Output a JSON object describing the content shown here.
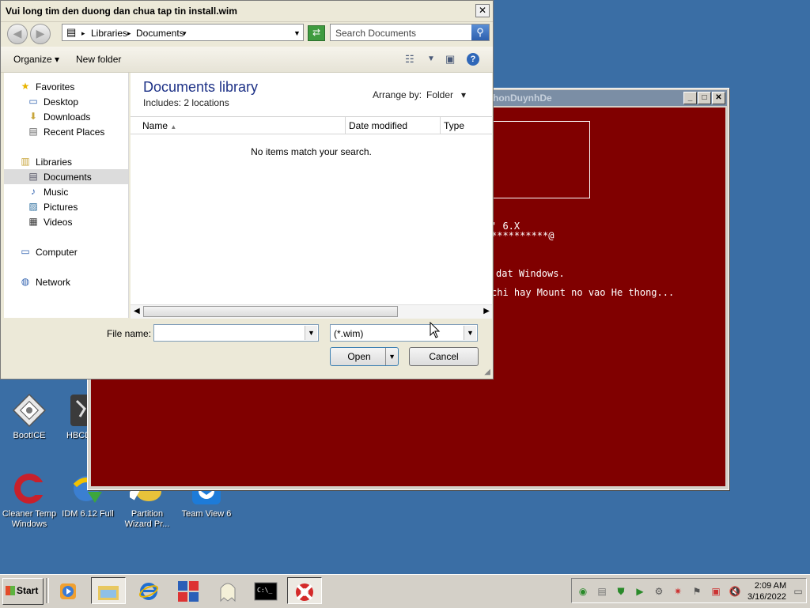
{
  "desktop": {
    "icons": [
      {
        "label": "BootICE"
      },
      {
        "label": "HBCD"
      },
      {
        "label": "Cleaner Temp Windows"
      },
      {
        "label": "IDM 6.12 Full"
      },
      {
        "label": "Partition Wizard Pr..."
      },
      {
        "label": "Team View 6"
      }
    ]
  },
  "console": {
    "title": "honDuynhDe",
    "lines": [
      "' 6.X",
      "**********@",
      "dat Windows.",
      "chi hay Mount no vao He thong..."
    ],
    "colors": {
      "background": "#800000",
      "text": "#ffffff"
    }
  },
  "dialog": {
    "title": "Vui long tim den duong dan chua tap tin install.wim",
    "breadcrumb": [
      "Libraries",
      "Documents"
    ],
    "search_placeholder": "Search Documents",
    "toolbar": {
      "organize": "Organize",
      "new_folder": "New folder"
    },
    "nav": {
      "favorites": "Favorites",
      "desktop": "Desktop",
      "downloads": "Downloads",
      "recent": "Recent Places",
      "libraries": "Libraries",
      "documents": "Documents",
      "music": "Music",
      "pictures": "Pictures",
      "videos": "Videos",
      "computer": "Computer",
      "network": "Network"
    },
    "library_title": "Documents library",
    "includes": "Includes:  2 locations",
    "arrange_label": "Arrange by:",
    "arrange_value": "Folder",
    "columns": [
      "Name",
      "Date modified",
      "Type"
    ],
    "empty_message": "No items match your search.",
    "filename_label": "File name:",
    "filename_value": "",
    "filetype_value": "(*.wim)",
    "open_label": "Open",
    "cancel_label": "Cancel"
  },
  "taskbar": {
    "start_label": "Start",
    "time": "2:09 AM",
    "date": "3/16/2022"
  }
}
